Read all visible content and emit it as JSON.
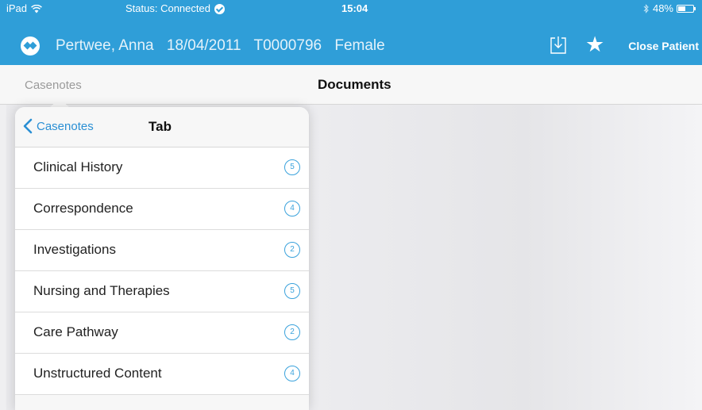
{
  "status_bar": {
    "device": "iPad",
    "status": "Status: Connected",
    "time": "15:04",
    "battery": "48%",
    "battery_level": 0.48
  },
  "patient": {
    "name": "Pertwee, Anna",
    "dob": "18/04/2011",
    "id": "T0000796",
    "gender": "Female"
  },
  "toolbar": {
    "download_icon": "download-icon",
    "star_icon": "star-icon",
    "close_label": "Close Patient"
  },
  "nav": {
    "back_label": "Casenotes",
    "title": "Documents"
  },
  "popover": {
    "back_label": "Casenotes",
    "title": "Tab",
    "items": [
      {
        "label": "Clinical History",
        "count": "5"
      },
      {
        "label": "Correspondence",
        "count": "4"
      },
      {
        "label": "Investigations",
        "count": "2"
      },
      {
        "label": "Nursing and Therapies",
        "count": "5"
      },
      {
        "label": "Care Pathway",
        "count": "2"
      },
      {
        "label": "Unstructured Content",
        "count": "4"
      }
    ]
  },
  "colors": {
    "header": "#2f9ed8",
    "accent": "#2a8fd4",
    "badge": "#3aa2dc"
  }
}
